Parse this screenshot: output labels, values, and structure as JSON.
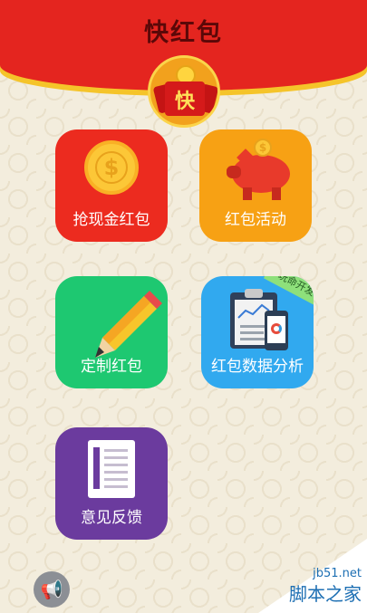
{
  "app": {
    "title": "快红包"
  },
  "badge": {
    "char": "快"
  },
  "tiles": [
    {
      "label": "抢现金红包",
      "icon": "coin-icon",
      "color": "#ec2b1f"
    },
    {
      "label": "红包活动",
      "icon": "piggy-bank-icon",
      "color": "#f7a114"
    },
    {
      "label": "定制红包",
      "icon": "pencil-icon",
      "color": "#1ec871"
    },
    {
      "label": "红包数据分析",
      "icon": "clipboard-chart-icon",
      "color": "#31a9ef",
      "ribbon": "玩命开发"
    },
    {
      "label": "意见反馈",
      "icon": "document-icon",
      "color": "#6b3b9e"
    }
  ],
  "coin_symbol": "$",
  "speaker_glyph": "📢",
  "watermark": {
    "site": "jb51.net",
    "name": "脚本之家"
  }
}
